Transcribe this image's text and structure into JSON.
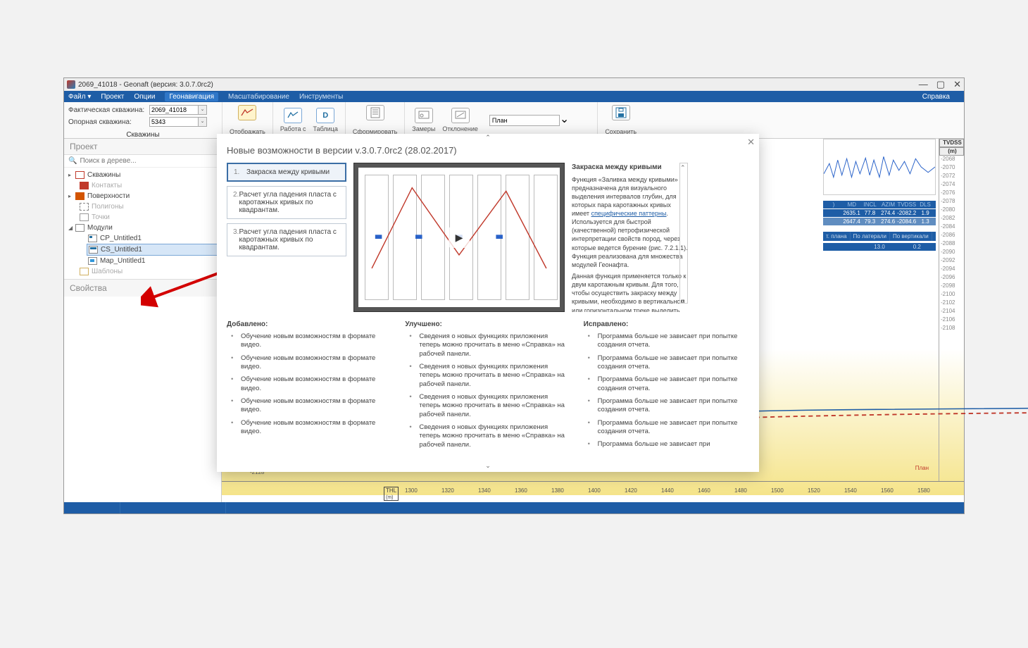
{
  "window": {
    "title": "2069_41018 - Geonaft (версия: 3.0.7.0rc2)",
    "min": "—",
    "max": "▢",
    "close": "✕"
  },
  "menu": {
    "file": "Файл",
    "file_caret": "▾",
    "project": "Проект",
    "options": "Опции",
    "geonav": "Геонавигация",
    "scale": "Масштабирование",
    "tools": "Инструменты",
    "help": "Справка"
  },
  "leftCombos": {
    "lbl1": "Фактическая скважина:",
    "val1": "2069_41018",
    "lbl2": "Опорная скважина:",
    "val2": "5343",
    "skv": "Скважины"
  },
  "ribbon": {
    "g1": "Отображать",
    "g2a": "Работа с",
    "g2b": "Таблица",
    "g3": "Сформировать",
    "g4a": "Замеры",
    "g4b": "Отклонение",
    "planVal": "План",
    "g5": "Сохранить",
    "icD": "D"
  },
  "sidebar": {
    "project": "Проект",
    "search": "Поиск в дереве...",
    "mag": "🔍",
    "items": {
      "skv": "Скважины",
      "kon": "Контакты",
      "pov": "Поверхности",
      "pol": "Полигоны",
      "tck": "Точки",
      "mod": "Модули",
      "cp": "CP_Untitled1",
      "cs": "CS_Untitled1",
      "map": "Map_Untitled1",
      "sha": "Шаблоны"
    },
    "props": "Свойства",
    "tri_r": "▸",
    "tri_d": "◢"
  },
  "rightTable": {
    "hd": {
      "md": "MD",
      "incl": "INCL",
      "azim": "AZIM",
      "tvdss": "TVDSS",
      "dls": "DLS"
    },
    "tvdss_hd": "TVDSS",
    "unit": "(m)",
    "r1": {
      "md": "2635.1",
      "incl": "77.8",
      "azim": "274.4",
      "tvdss": "-2082.2",
      "dls": "1.9"
    },
    "r2": {
      "md": "2647.4",
      "incl": "79.3",
      "azim": "274.6",
      "tvdss": "-2084.6",
      "dls": "1.3"
    },
    "tabs": {
      "a": "т. плана",
      "b": "По латерали",
      "c": "По вертикали"
    },
    "vals": {
      "a": "13.0",
      "b": "0.2"
    }
  },
  "axis": {
    "thl": "THL",
    "thlu": "(m)",
    "x": [
      "1300",
      "1320",
      "1340",
      "1360",
      "1380",
      "1400",
      "1420",
      "1440",
      "1460",
      "1480",
      "1500",
      "1520",
      "1540",
      "1560",
      "1580"
    ],
    "y": [
      "-2068",
      "-2070",
      "-2072",
      "-2074",
      "-2076",
      "-2078",
      "-2080",
      "-2082",
      "-2084",
      "-2086",
      "-2088",
      "-2090",
      "-2092",
      "-2094",
      "-2096",
      "-2098",
      "-2100",
      "-2102",
      "-2104",
      "-2106",
      "-2108"
    ],
    "yl": [
      "-2128",
      "-2128"
    ],
    "plan_lbl": "План"
  },
  "dialog": {
    "title": "Новые возможности в версии v.3.0.7.0rc2 (28.02.2017)",
    "close": "✕",
    "nav": [
      {
        "n": "1.",
        "t": "Закраска между кривыми"
      },
      {
        "n": "2.",
        "t": "Расчет угла падения пласта с каротажных кривых по квадрантам."
      },
      {
        "n": "3.",
        "t": "Расчет угла падения пласта с каротажных кривых по квадрантам."
      }
    ],
    "desc": {
      "title": "Закраска между кривыми",
      "p1": "Функция «Заливка между кривыми» предназначена для визуального выделения интервалов глубин, для которых пара каротажных кривых имеет ",
      "link": "специфические паттерны",
      "p2": ". Используется для быстрой (качественной) петрофизической интерпретации свойств пород, через которые ведется бурение (рис. 7.2.1.1). Функция реализована для множества модулей Геонафта.",
      "p3": "Данная функция применяется только к двум каротажным кривым. Для того, чтобы осуществить закраску между кривыми, необходимо в вертикальном или горизонтальном треке выделить одну из кривых и перейти в ее свойства."
    },
    "up": "⌃",
    "dn": "⌄",
    "cols": {
      "add": {
        "h": "Добавлено:",
        "it": "Обучение новым возможностям в формате видео."
      },
      "imp": {
        "h": "Улучшено:",
        "it": "Сведения о новых функциях приложения теперь можно прочитать в меню «Справка» на рабочей панели."
      },
      "fix": {
        "h": "Исправлено:",
        "it": "Программа больше не зависает при попытке создания отчета.",
        "it2": "Программа больше не зависает при",
        "it3": "попытке создания отчета."
      }
    }
  }
}
